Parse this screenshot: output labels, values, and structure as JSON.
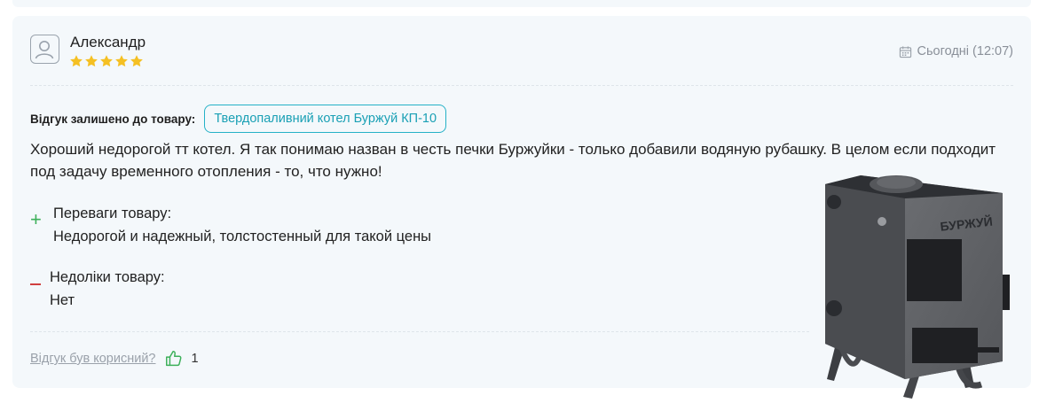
{
  "review": {
    "author": "Александр",
    "rating": 5,
    "rating_max": 5,
    "date": "Сьогодні (12:07)",
    "product_label": "Відгук залишено до товару:",
    "product_name": "Твердопаливний котел Буржуй КП-10",
    "text": "Хороший недорогой тт котел. Я так понимаю назван в честь печки Буржуйки - только добавили водяную рубашку. В целом если подходит под задачу временного отопления - то, что нужно!",
    "pros_sign": "+",
    "pros_title": "Переваги товару:",
    "pros_text": "Недорогой и надежный, толстостенный для такой цены",
    "cons_title": "Недоліки товару:",
    "cons_text": "Нет",
    "helpful_label": "Відгук був корисний?",
    "likes": "1",
    "photo_brand_text": "БУРЖУЙ"
  },
  "icons": {
    "avatar": "user-avatar-icon",
    "star": "star-icon",
    "calendar": "calendar-icon",
    "like": "thumbs-up-icon"
  },
  "colors": {
    "card_bg": "#f4f8fb",
    "star": "#f5c023",
    "accent": "#25b1c7",
    "pros": "#3db05a",
    "cons": "#d04040",
    "muted": "#8a9099"
  }
}
